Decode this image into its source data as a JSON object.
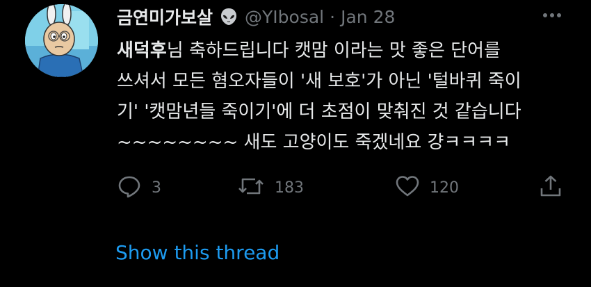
{
  "tweet": {
    "author": {
      "display_name": "금연미가보살",
      "badge_icon": "alien-emoji-icon",
      "handle": "@YIbosal",
      "separator": "·",
      "date": "Jan 28",
      "avatar_icon": "cartoon-avatar-image"
    },
    "more_icon": "more-horizontal-icon",
    "text": {
      "line1_strong": "새덕후",
      "line1_rest": "님 축하드립니다 캣맘 이라는 맛 좋은 단어를",
      "line2": "쓰셔서 모든 혐오자들이 '새 보호'가 아닌 '털바퀴 죽이",
      "line3": "기' '캣맘년들 죽이기'에 더 초점이 맞춰진 것 같습니다",
      "line4": "~~~~~~~~ 새도 고양이도 죽겠네요 걍ㅋㅋㅋㅋ"
    },
    "actions": {
      "reply_icon": "reply-bubble-icon",
      "reply_count": "3",
      "retweet_icon": "retweet-icon",
      "retweet_count": "183",
      "like_icon": "heart-icon",
      "like_count": "120",
      "share_icon": "share-icon"
    },
    "show_thread": "Show this thread"
  },
  "colors": {
    "background": "#000000",
    "primary_text": "#e7e9ea",
    "secondary_text": "#71767b",
    "link": "#1d9bf0"
  }
}
